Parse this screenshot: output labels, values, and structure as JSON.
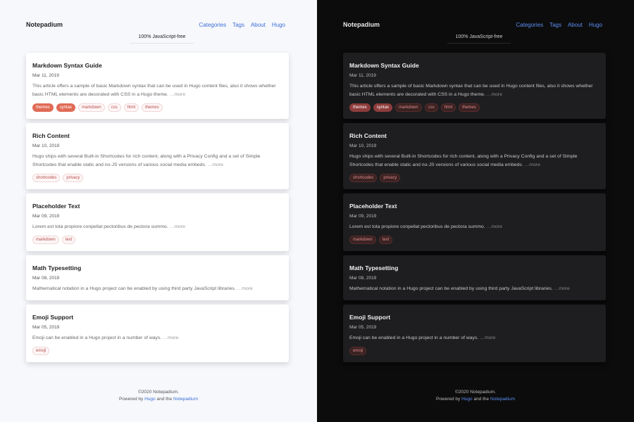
{
  "site": {
    "title": "Notepadium"
  },
  "nav": [
    {
      "label": "Categories"
    },
    {
      "label": "Tags"
    },
    {
      "label": "About"
    },
    {
      "label": "Hugo"
    }
  ],
  "badge": "100% JavaScript-free",
  "posts": [
    {
      "title": "Markdown Syntax Guide",
      "date": "Mar 11, 2019",
      "summary": "This article offers a sample of basic Markdown syntax that can be used in Hugo content files, also it shows whether basic HTML elements are decorated with CSS in a Hugo theme.",
      "more": "…more",
      "tags": [
        {
          "label": "themes",
          "style": "solid"
        },
        {
          "label": "syntax",
          "style": "solid"
        },
        {
          "label": "markdown",
          "style": "outline"
        },
        {
          "label": "css",
          "style": "outline"
        },
        {
          "label": "html",
          "style": "outline"
        },
        {
          "label": "themes",
          "style": "outline"
        }
      ]
    },
    {
      "title": "Rich Content",
      "date": "Mar 10, 2019",
      "summary": "Hugo ships with several Built-in Shortcodes for rich content, along with a Privacy Config and a set of Simple Shortcodes that enable static and no-JS versions of various social media embeds.",
      "more": "…more",
      "tags": [
        {
          "label": "shortcodes",
          "style": "outline"
        },
        {
          "label": "privacy",
          "style": "outline"
        }
      ]
    },
    {
      "title": "Placeholder Text",
      "date": "Mar 09, 2019",
      "summary": "Lorem est tota propiore conpellat pectoribus de pectora summo.",
      "more": "…more",
      "tags": [
        {
          "label": "markdown",
          "style": "outline"
        },
        {
          "label": "text",
          "style": "outline"
        }
      ]
    },
    {
      "title": "Math Typesetting",
      "date": "Mar 08, 2019",
      "summary": "Mathematical notation in a Hugo project can be enabled by using third party JavaScript libraries.",
      "more": "…more",
      "tags": []
    },
    {
      "title": "Emoji Support",
      "date": "Mar 05, 2019",
      "summary": "Emoji can be enabled in a Hugo project in a number of ways.",
      "more": "…more",
      "tags": [
        {
          "label": "emoji",
          "style": "outline"
        }
      ]
    }
  ],
  "footer": {
    "copyright": "©2020 Notepadium.",
    "powered_prefix": "Powered by",
    "hugo_link": "Hugo",
    "and_text": "and the",
    "theme_link": "Notepadium"
  },
  "colors": {
    "light_bg": "#f7f8fc",
    "dark_bg": "#0c0c0d",
    "accent": "#3b6fd4",
    "tag_accent": "#e06b55"
  }
}
